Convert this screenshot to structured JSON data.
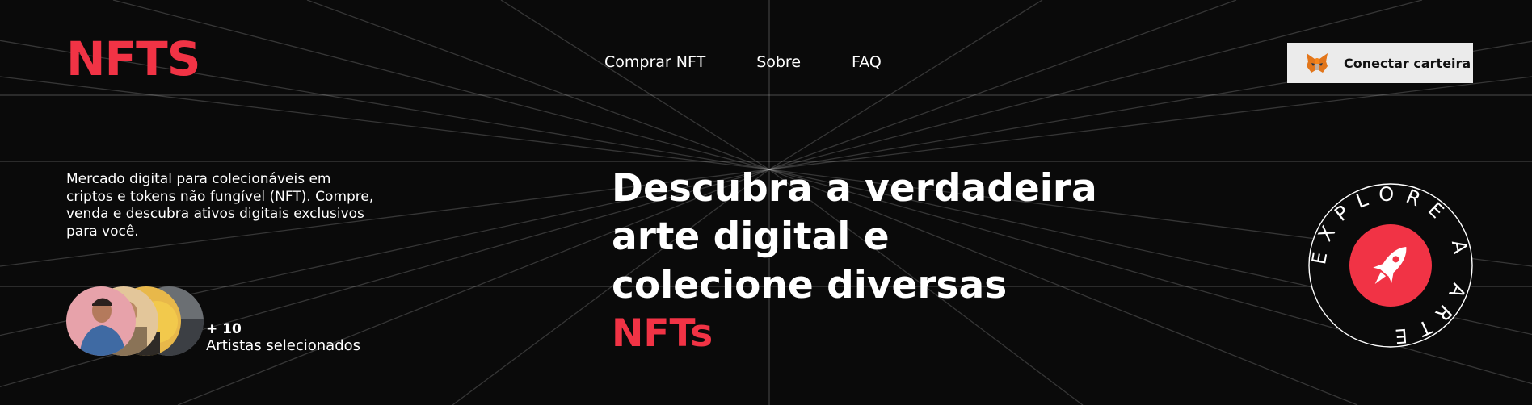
{
  "brand": {
    "logo": "NFTS",
    "accent_color": "#f13345"
  },
  "nav": {
    "items": [
      "Comprar NFT",
      "Sobre",
      "FAQ"
    ]
  },
  "wallet": {
    "label": "Conectar carteira",
    "icon": "metamask-fox-icon"
  },
  "intro": {
    "text": "Mercado digital para colecionáveis em criptos e tokens não fungível (NFT). Compre, venda e descubra ativos digitais exclusivos para você."
  },
  "artists": {
    "count": "+ 10",
    "caption": "Artistas selecionados"
  },
  "hero": {
    "line1": "Descubra a verdadeira",
    "line2": "arte digital e",
    "line3": "colecione diversas",
    "accent": "NFTs"
  },
  "badge": {
    "text": "EXPLORE A ARTE",
    "icon": "rocket-icon"
  }
}
